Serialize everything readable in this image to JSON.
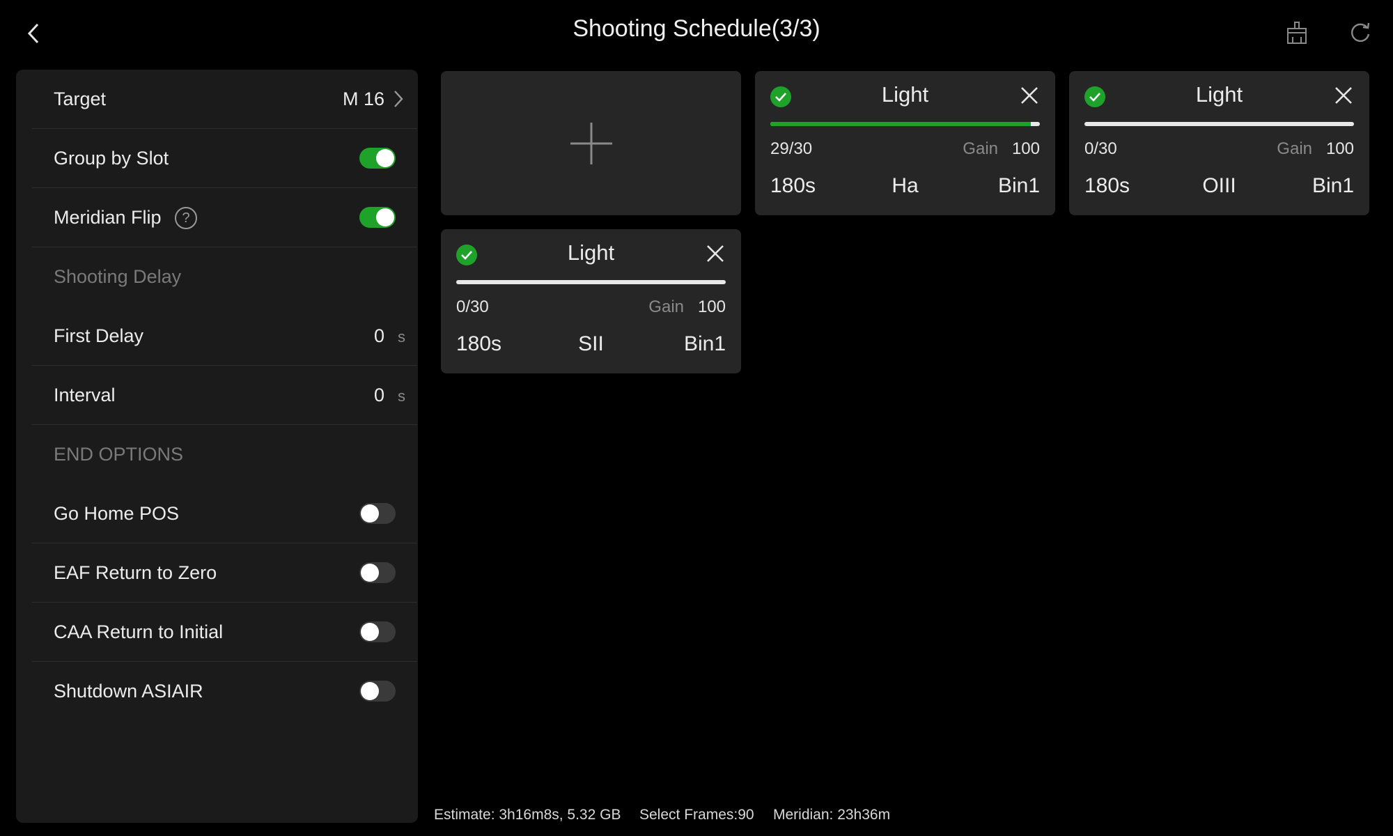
{
  "header": {
    "title": "Shooting Schedule(3/3)",
    "icons": {
      "back": "chevron-left-icon",
      "clear": "broom-icon",
      "refresh": "refresh-icon"
    }
  },
  "sidebar": {
    "target_label": "Target",
    "target_value": "M 16",
    "group_by_slot_label": "Group by Slot",
    "group_by_slot_on": true,
    "meridian_flip_label": "Meridian Flip",
    "meridian_flip_help": "?",
    "meridian_flip_on": true,
    "shooting_delay_header": "Shooting Delay",
    "first_delay_label": "First Delay",
    "first_delay_value": "0",
    "first_delay_unit": "s",
    "interval_label": "Interval",
    "interval_value": "0",
    "interval_unit": "s",
    "end_options_header": "END OPTIONS",
    "go_home_label": "Go Home POS",
    "go_home_on": false,
    "eaf_label": "EAF Return to Zero",
    "eaf_on": false,
    "caa_label": "CAA Return to Initial",
    "caa_on": false,
    "shutdown_label": "Shutdown ASIAIR",
    "shutdown_on": false
  },
  "cards": [
    {
      "title": "Light",
      "count": "29/30",
      "gain_label": "Gain",
      "gain": "100",
      "exposure": "180s",
      "filter": "Ha",
      "bin": "Bin1",
      "progress": 0.967
    },
    {
      "title": "Light",
      "count": "0/30",
      "gain_label": "Gain",
      "gain": "100",
      "exposure": "180s",
      "filter": "OIII",
      "bin": "Bin1",
      "progress": 0
    },
    {
      "title": "Light",
      "count": "0/30",
      "gain_label": "Gain",
      "gain": "100",
      "exposure": "180s",
      "filter": "SII",
      "bin": "Bin1",
      "progress": 0
    }
  ],
  "footer": {
    "estimate": "Estimate: 3h16m8s, 5.32 GB",
    "select_frames": "Select Frames:90",
    "meridian": "Meridian: 23h36m"
  },
  "colors": {
    "accent": "#1fa22a",
    "panel": "#1b1b1b",
    "card": "#262626",
    "background": "#000000"
  }
}
